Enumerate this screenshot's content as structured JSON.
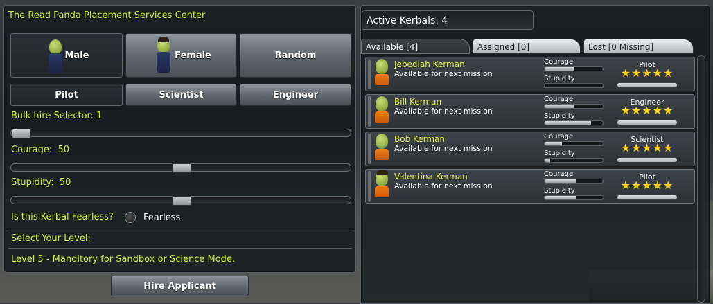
{
  "left_panel": {
    "title": "The Read Panda Placement Services Center",
    "gender_buttons": [
      {
        "label": "Male",
        "selected": true
      },
      {
        "label": "Female",
        "selected": false
      },
      {
        "label": "Random",
        "selected": false
      }
    ],
    "job_buttons": [
      {
        "label": "Pilot",
        "selected": true
      },
      {
        "label": "Scientist",
        "selected": false
      },
      {
        "label": "Engineer",
        "selected": false
      }
    ],
    "bulk_label": "Bulk hire Selector: 1",
    "bulk_value": 1,
    "courage_label": "Courage:  50",
    "courage_value": 50,
    "stupidity_label": "Stupidity:  50",
    "stupidity_value": 50,
    "fearless_question": "Is this Kerbal Fearless?",
    "fearless_option": "Fearless",
    "select_level_label": "Select Your Level:",
    "level_text": "Level 5 - Manditory for Sandbox or Science Mode.",
    "hire_button": "Hire Applicant"
  },
  "right_panel": {
    "header": "Active Kerbals: 4",
    "tabs": [
      {
        "label": "Available [4]",
        "active": true
      },
      {
        "label": "Assigned [0]",
        "active": false
      },
      {
        "label": "Lost [0 Missing]",
        "active": false
      }
    ],
    "courage_label": "Courage",
    "stupidity_label": "Stupidity",
    "kerbals": [
      {
        "name": "Jebediah Kerman",
        "status": "Available for next mission",
        "trait": "Pilot",
        "stars": "★★★★★",
        "courage": 0.5,
        "stupidity": 0.0
      },
      {
        "name": "Bill Kerman",
        "status": "Available for next mission",
        "trait": "Engineer",
        "stars": "★★★★★",
        "courage": 0.5,
        "stupidity": 0.8
      },
      {
        "name": "Bob Kerman",
        "status": "Available for next mission",
        "trait": "Scientist",
        "stars": "★★★★★",
        "courage": 0.3,
        "stupidity": 0.1
      },
      {
        "name": "Valentina Kerman",
        "status": "Available for next mission",
        "trait": "Pilot",
        "stars": "★★★★★",
        "courage": 0.55,
        "stupidity": 0.55
      }
    ]
  },
  "colors": {
    "accent_green": "#c8f03a",
    "name_yellow": "#e7ef4a",
    "star_gold": "#ffd21a"
  }
}
